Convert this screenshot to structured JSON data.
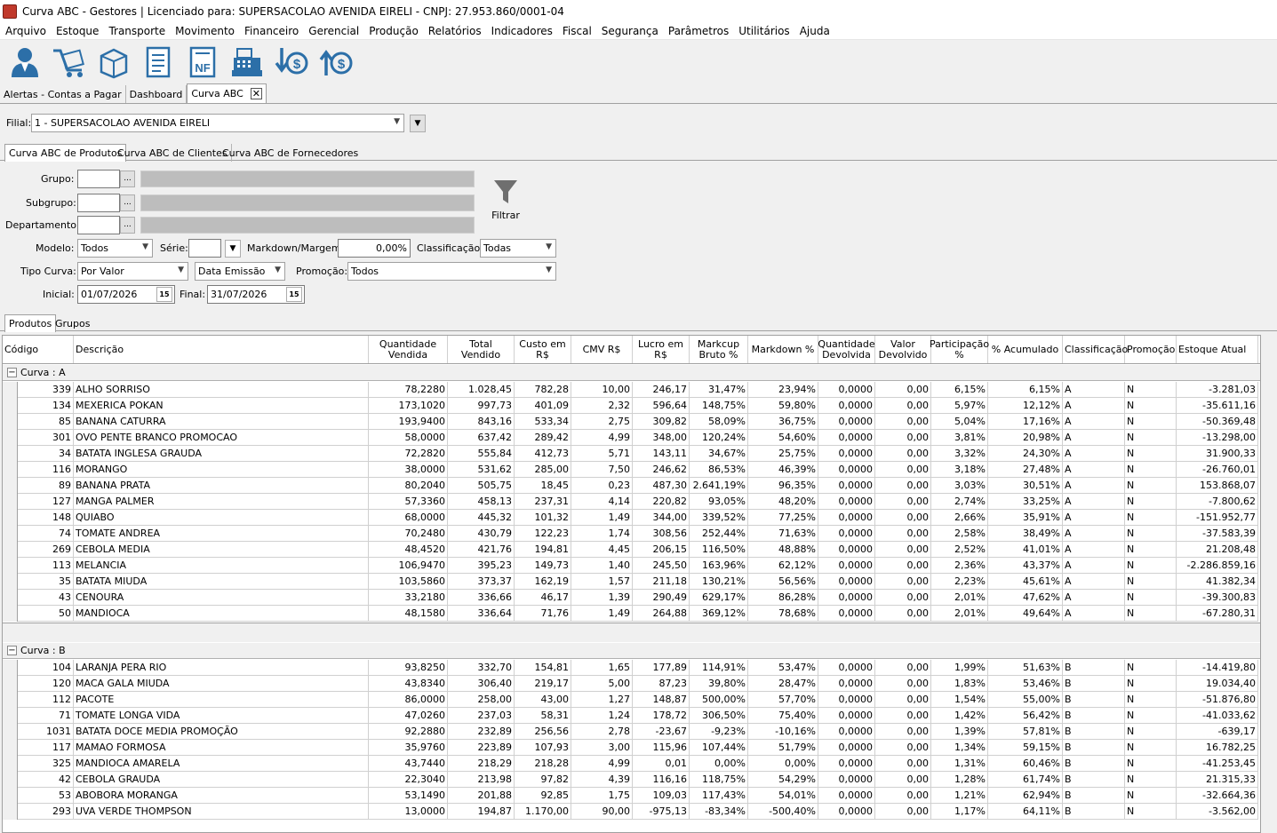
{
  "window": {
    "title": "Curva ABC - Gestores | Licenciado para: SUPERSACOLAO AVENIDA EIRELI - CNPJ: 27.953.860/0001-04"
  },
  "menu": [
    "Arquivo",
    "Estoque",
    "Transporte",
    "Movimento",
    "Financeiro",
    "Gerencial",
    "Produção",
    "Relatórios",
    "Indicadores",
    "Fiscal",
    "Segurança",
    "Parâmetros",
    "Utilitários",
    "Ajuda"
  ],
  "toolbar": {
    "icons": [
      "user-icon",
      "cart-icon",
      "box-icon",
      "document-list-icon",
      "nfe-icon",
      "cash-register-icon",
      "money-down-icon",
      "money-up-icon"
    ],
    "nf_text": "NF"
  },
  "doc_tabs": [
    "Alertas - Contas a Pagar",
    "Dashboard",
    "Curva ABC"
  ],
  "close_glyph": "✕",
  "filial": {
    "label": "Filial:",
    "value": "1 - SUPERSACOLAO AVENIDA EIRELI"
  },
  "sub_tabs": [
    "Curva ABC de Produtos",
    "Curva ABC de Clientes",
    "Curva ABC de Fornecedores"
  ],
  "filters": {
    "grupo_label": "Grupo:",
    "subgrupo_label": "Subgrupo:",
    "departamento_label": "Departamento:",
    "ellipsis": "...",
    "filtrar_label": "Filtrar",
    "modelo_label": "Modelo:",
    "modelo_value": "Todos",
    "serie_label": "Série:",
    "serie_value": "",
    "markdown_label": "Markdown/Margem:",
    "markdown_value": "0,00%",
    "classificacao_label": "Classificação:",
    "classificacao_value": "Todas",
    "tipo_curva_label": "Tipo Curva:",
    "tipo_curva_value": "Por Valor",
    "data_tipo_value": "Data Emissão",
    "promocao_label": "Promoção:",
    "promocao_value": "Todos",
    "inicial_label": "Inicial:",
    "inicial_value": "01/07/2026",
    "final_label": "Final:",
    "final_value": "31/07/2026",
    "calendar_glyph": "15"
  },
  "result_tabs": [
    "Produtos",
    "Grupos"
  ],
  "grid": {
    "headers": [
      "Código",
      "Descrição",
      "Quantidade Vendida",
      "Total Vendido",
      "Custo em R$",
      "CMV R$",
      "Lucro em R$",
      "Markcup Bruto %",
      "Markdown %",
      "Quantidade Devolvida",
      "Valor Devolvido",
      "Participação %",
      "% Acumulado",
      "Classificação",
      "Promoção",
      "Estoque Atual"
    ],
    "groups": [
      {
        "label": "Curva : A",
        "rows": [
          [
            "339",
            "ALHO SORRISO",
            "78,2280",
            "1.028,45",
            "782,28",
            "10,00",
            "246,17",
            "31,47%",
            "23,94%",
            "0,0000",
            "0,00",
            "6,15%",
            "6,15%",
            "A",
            "N",
            "-3.281,03"
          ],
          [
            "134",
            "MEXERICA POKAN",
            "173,1020",
            "997,73",
            "401,09",
            "2,32",
            "596,64",
            "148,75%",
            "59,80%",
            "0,0000",
            "0,00",
            "5,97%",
            "12,12%",
            "A",
            "N",
            "-35.611,16"
          ],
          [
            "85",
            "BANANA CATURRA",
            "193,9400",
            "843,16",
            "533,34",
            "2,75",
            "309,82",
            "58,09%",
            "36,75%",
            "0,0000",
            "0,00",
            "5,04%",
            "17,16%",
            "A",
            "N",
            "-50.369,48"
          ],
          [
            "301",
            "OVO PENTE BRANCO PROMOCAO",
            "58,0000",
            "637,42",
            "289,42",
            "4,99",
            "348,00",
            "120,24%",
            "54,60%",
            "0,0000",
            "0,00",
            "3,81%",
            "20,98%",
            "A",
            "N",
            "-13.298,00"
          ],
          [
            "34",
            "BATATA INGLESA GRAUDA",
            "72,2820",
            "555,84",
            "412,73",
            "5,71",
            "143,11",
            "34,67%",
            "25,75%",
            "0,0000",
            "0,00",
            "3,32%",
            "24,30%",
            "A",
            "N",
            "31.900,33"
          ],
          [
            "116",
            "MORANGO",
            "38,0000",
            "531,62",
            "285,00",
            "7,50",
            "246,62",
            "86,53%",
            "46,39%",
            "0,0000",
            "0,00",
            "3,18%",
            "27,48%",
            "A",
            "N",
            "-26.760,01"
          ],
          [
            "89",
            "BANANA PRATA",
            "80,2040",
            "505,75",
            "18,45",
            "0,23",
            "487,30",
            "2.641,19%",
            "96,35%",
            "0,0000",
            "0,00",
            "3,03%",
            "30,51%",
            "A",
            "N",
            "153.868,07"
          ],
          [
            "127",
            "MANGA PALMER",
            "57,3360",
            "458,13",
            "237,31",
            "4,14",
            "220,82",
            "93,05%",
            "48,20%",
            "0,0000",
            "0,00",
            "2,74%",
            "33,25%",
            "A",
            "N",
            "-7.800,62"
          ],
          [
            "148",
            "QUIABO",
            "68,0000",
            "445,32",
            "101,32",
            "1,49",
            "344,00",
            "339,52%",
            "77,25%",
            "0,0000",
            "0,00",
            "2,66%",
            "35,91%",
            "A",
            "N",
            "-151.952,77"
          ],
          [
            "74",
            "TOMATE ANDREA",
            "70,2480",
            "430,79",
            "122,23",
            "1,74",
            "308,56",
            "252,44%",
            "71,63%",
            "0,0000",
            "0,00",
            "2,58%",
            "38,49%",
            "A",
            "N",
            "-37.583,39"
          ],
          [
            "269",
            "CEBOLA MEDIA",
            "48,4520",
            "421,76",
            "194,81",
            "4,45",
            "206,15",
            "116,50%",
            "48,88%",
            "0,0000",
            "0,00",
            "2,52%",
            "41,01%",
            "A",
            "N",
            "21.208,48"
          ],
          [
            "113",
            "MELANCIA",
            "106,9470",
            "395,23",
            "149,73",
            "1,40",
            "245,50",
            "163,96%",
            "62,12%",
            "0,0000",
            "0,00",
            "2,36%",
            "43,37%",
            "A",
            "N",
            "-2.286.859,16"
          ],
          [
            "35",
            "BATATA MIUDA",
            "103,5860",
            "373,37",
            "162,19",
            "1,57",
            "211,18",
            "130,21%",
            "56,56%",
            "0,0000",
            "0,00",
            "2,23%",
            "45,61%",
            "A",
            "N",
            "41.382,34"
          ],
          [
            "43",
            "CENOURA",
            "33,2180",
            "336,66",
            "46,17",
            "1,39",
            "290,49",
            "629,17%",
            "86,28%",
            "0,0000",
            "0,00",
            "2,01%",
            "47,62%",
            "A",
            "N",
            "-39.300,83"
          ],
          [
            "50",
            "MANDIOCA",
            "48,1580",
            "336,64",
            "71,76",
            "1,49",
            "264,88",
            "369,12%",
            "78,68%",
            "0,0000",
            "0,00",
            "2,01%",
            "49,64%",
            "A",
            "N",
            "-67.280,31"
          ]
        ]
      },
      {
        "label": "Curva : B",
        "rows": [
          [
            "104",
            "LARANJA PERA RIO",
            "93,8250",
            "332,70",
            "154,81",
            "1,65",
            "177,89",
            "114,91%",
            "53,47%",
            "0,0000",
            "0,00",
            "1,99%",
            "51,63%",
            "B",
            "N",
            "-14.419,80"
          ],
          [
            "120",
            "MACA GALA MIUDA",
            "43,8340",
            "306,40",
            "219,17",
            "5,00",
            "87,23",
            "39,80%",
            "28,47%",
            "0,0000",
            "0,00",
            "1,83%",
            "53,46%",
            "B",
            "N",
            "19.034,40"
          ],
          [
            "112",
            "PACOTE",
            "86,0000",
            "258,00",
            "43,00",
            "1,27",
            "148,87",
            "500,00%",
            "57,70%",
            "0,0000",
            "0,00",
            "1,54%",
            "55,00%",
            "B",
            "N",
            "-51.876,80"
          ],
          [
            "71",
            "TOMATE LONGA VIDA",
            "47,0260",
            "237,03",
            "58,31",
            "1,24",
            "178,72",
            "306,50%",
            "75,40%",
            "0,0000",
            "0,00",
            "1,42%",
            "56,42%",
            "B",
            "N",
            "-41.033,62"
          ],
          [
            "1031",
            "BATATA DOCE MEDIA PROMOÇÃO",
            "92,2880",
            "232,89",
            "256,56",
            "2,78",
            "-23,67",
            "-9,23%",
            "-10,16%",
            "0,0000",
            "0,00",
            "1,39%",
            "57,81%",
            "B",
            "N",
            "-639,17"
          ],
          [
            "117",
            "MAMAO FORMOSA",
            "35,9760",
            "223,89",
            "107,93",
            "3,00",
            "115,96",
            "107,44%",
            "51,79%",
            "0,0000",
            "0,00",
            "1,34%",
            "59,15%",
            "B",
            "N",
            "16.782,25"
          ],
          [
            "325",
            "MANDIOCA AMARELA",
            "43,7440",
            "218,29",
            "218,28",
            "4,99",
            "0,01",
            "0,00%",
            "0,00%",
            "0,0000",
            "0,00",
            "1,31%",
            "60,46%",
            "B",
            "N",
            "-41.253,45"
          ],
          [
            "42",
            "CEBOLA GRAUDA",
            "22,3040",
            "213,98",
            "97,82",
            "4,39",
            "116,16",
            "118,75%",
            "54,29%",
            "0,0000",
            "0,00",
            "1,28%",
            "61,74%",
            "B",
            "N",
            "21.315,33"
          ],
          [
            "53",
            "ABOBORA MORANGA",
            "53,1490",
            "201,88",
            "92,85",
            "1,75",
            "109,03",
            "117,43%",
            "54,01%",
            "0,0000",
            "0,00",
            "1,21%",
            "62,94%",
            "B",
            "N",
            "-32.664,36"
          ],
          [
            "293",
            "UVA VERDE THOMPSON",
            "13,0000",
            "194,87",
            "1.170,00",
            "90,00",
            "-975,13",
            "-83,34%",
            "-500,40%",
            "0,0000",
            "0,00",
            "1,17%",
            "64,11%",
            "B",
            "N",
            "-3.562,00"
          ]
        ]
      }
    ]
  }
}
